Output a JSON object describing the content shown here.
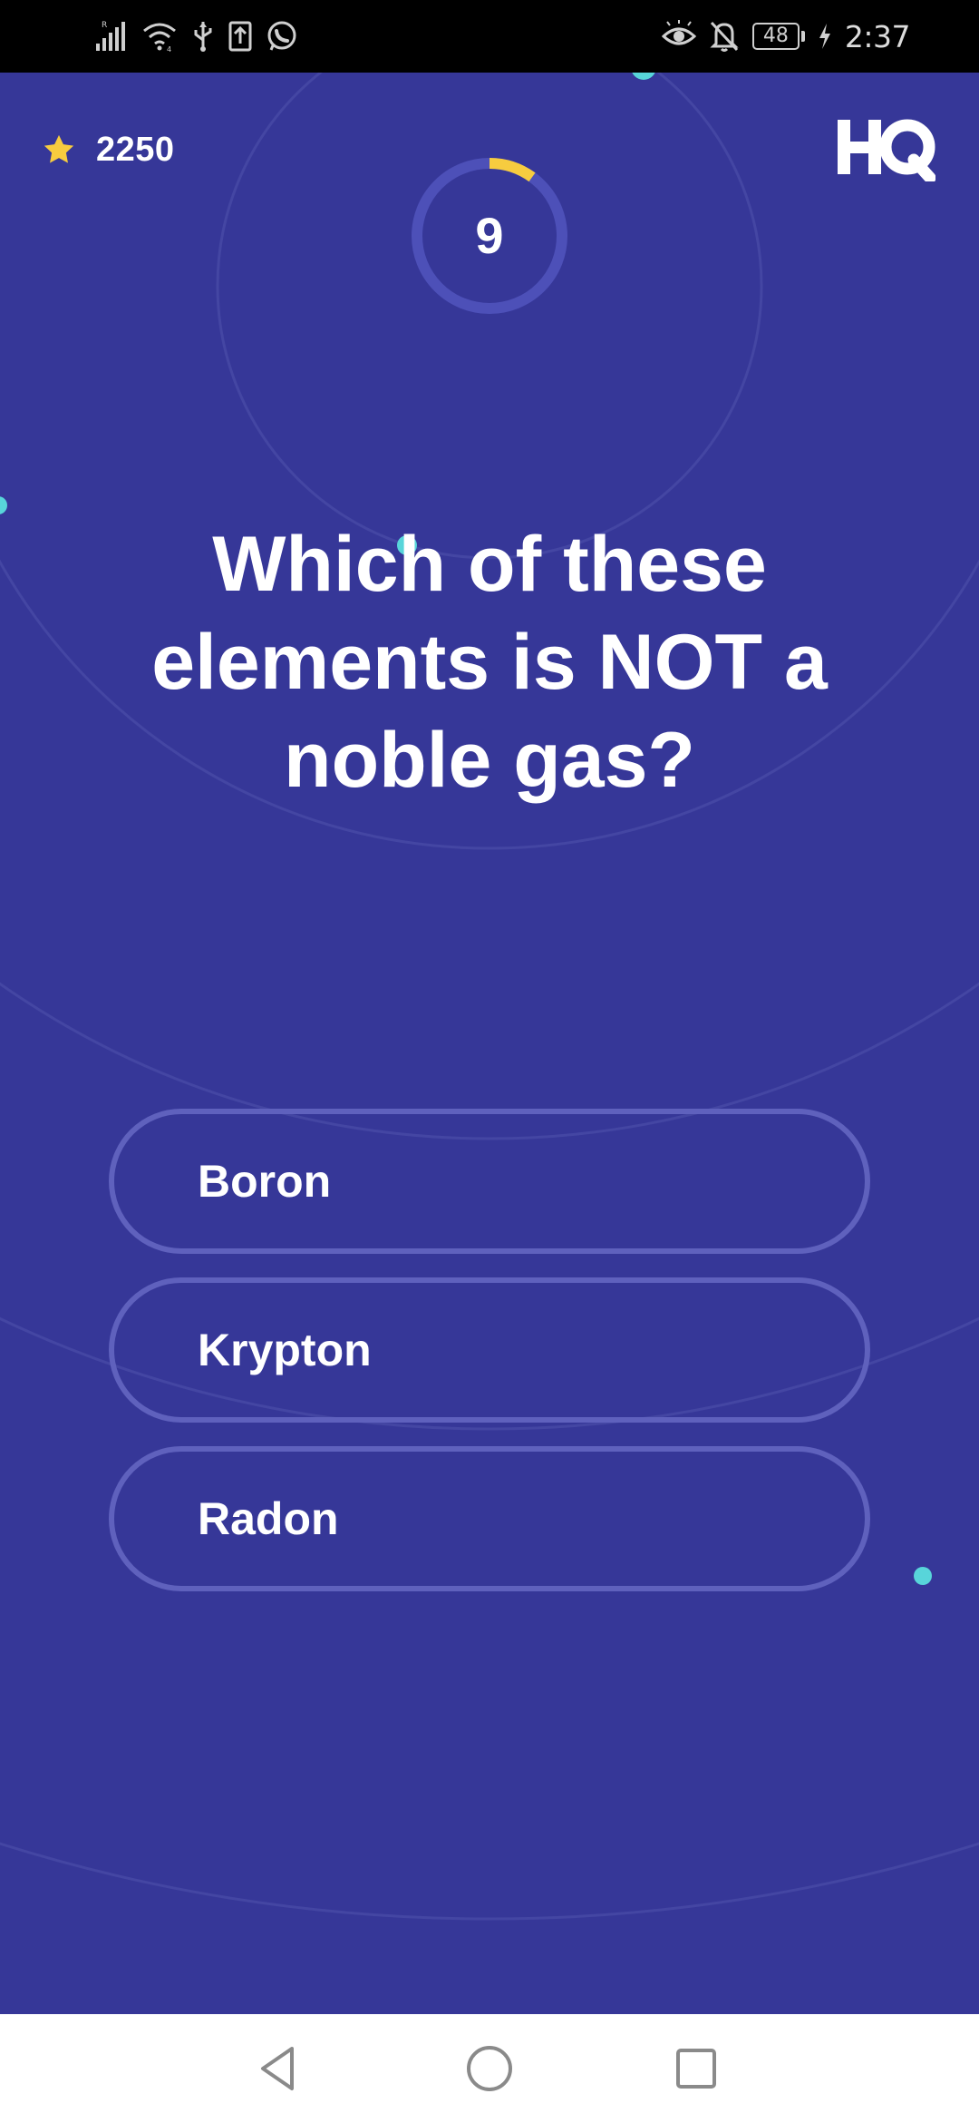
{
  "status_bar": {
    "time": "2:37",
    "battery": "48",
    "left_icons": [
      "signal-icon",
      "wifi-icon",
      "usb-icon",
      "upload-icon",
      "whatsapp-icon"
    ],
    "right_icons": [
      "eye-icon",
      "bell-off-icon",
      "battery-icon",
      "charging-icon"
    ]
  },
  "game": {
    "score": "2250",
    "timer": "9",
    "timer_progress": 0.1,
    "question": "Which of these elements is NOT a noble gas?",
    "answers": [
      {
        "label": "Boron"
      },
      {
        "label": "Krypton"
      },
      {
        "label": "Radon"
      }
    ],
    "logo_icon": "hq-logo-icon",
    "score_icon": "star-icon"
  },
  "nav_bar": {
    "icons": [
      "back-icon",
      "home-icon",
      "recents-icon"
    ]
  },
  "colors": {
    "background": "#363798",
    "ring": "#5f61bd",
    "timer_ring": "#4d50b8",
    "timer_progress": "#f7cc3f",
    "star": "#f7cc3f",
    "dot": "#58d5da",
    "text": "#ffffff",
    "status_bar": "#000000",
    "nav_bar": "#ffffff"
  }
}
